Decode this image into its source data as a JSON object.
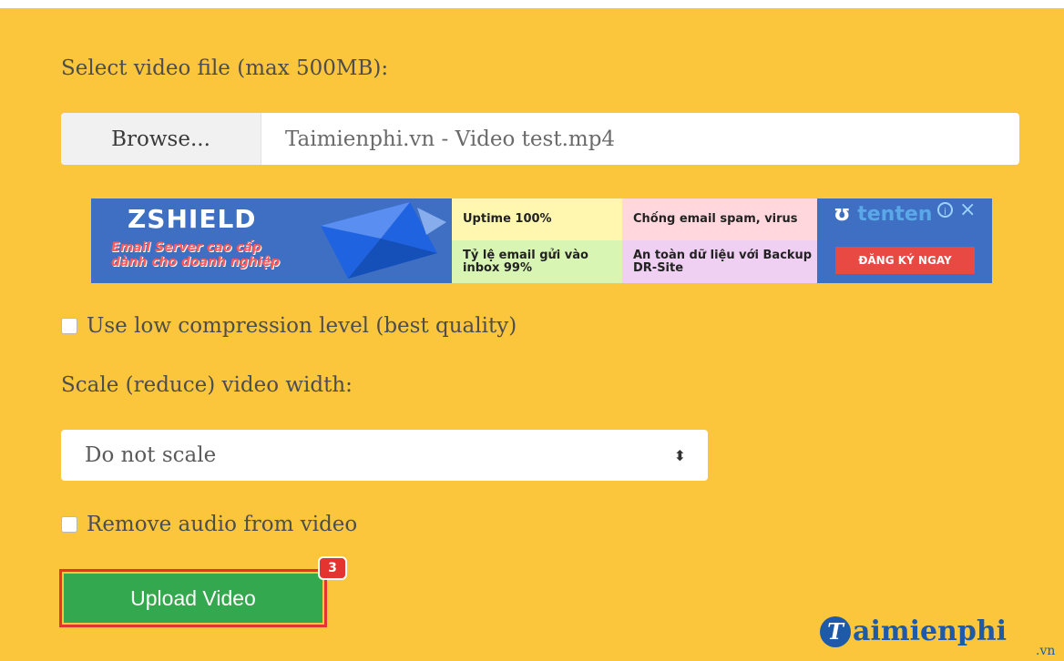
{
  "form": {
    "file_label": "Select video file (max 500MB):",
    "browse_button": "Browse...",
    "file_name": "Taimienphi.vn - Video test.mp4",
    "low_compression_label": "Use low compression level (best quality)",
    "scale_label": "Scale (reduce) video width:",
    "scale_selected": "Do not scale",
    "remove_audio_label": "Remove audio from video",
    "upload_button": "Upload Video",
    "step_badge": "3"
  },
  "ad": {
    "brand": "ZSHIELD",
    "tagline_1": "Email Server cao cấp",
    "tagline_2": "dành cho doanh nghiệp",
    "cell_1": "Uptime 100%",
    "cell_2": "Chống email spam, virus",
    "cell_3": "Tỷ lệ email gửi vào inbox 99%",
    "cell_4": "An toàn dữ liệu với Backup DR-Site",
    "logo_text": "tenten",
    "cta": "ĐĂNG KÝ NGAY"
  },
  "watermark": {
    "logo_letter": "T",
    "text": "aimienphi",
    "suffix": ".vn"
  },
  "colors": {
    "background": "#fbc63c",
    "upload_button": "#34a84e",
    "highlight_border": "#e3342f"
  }
}
